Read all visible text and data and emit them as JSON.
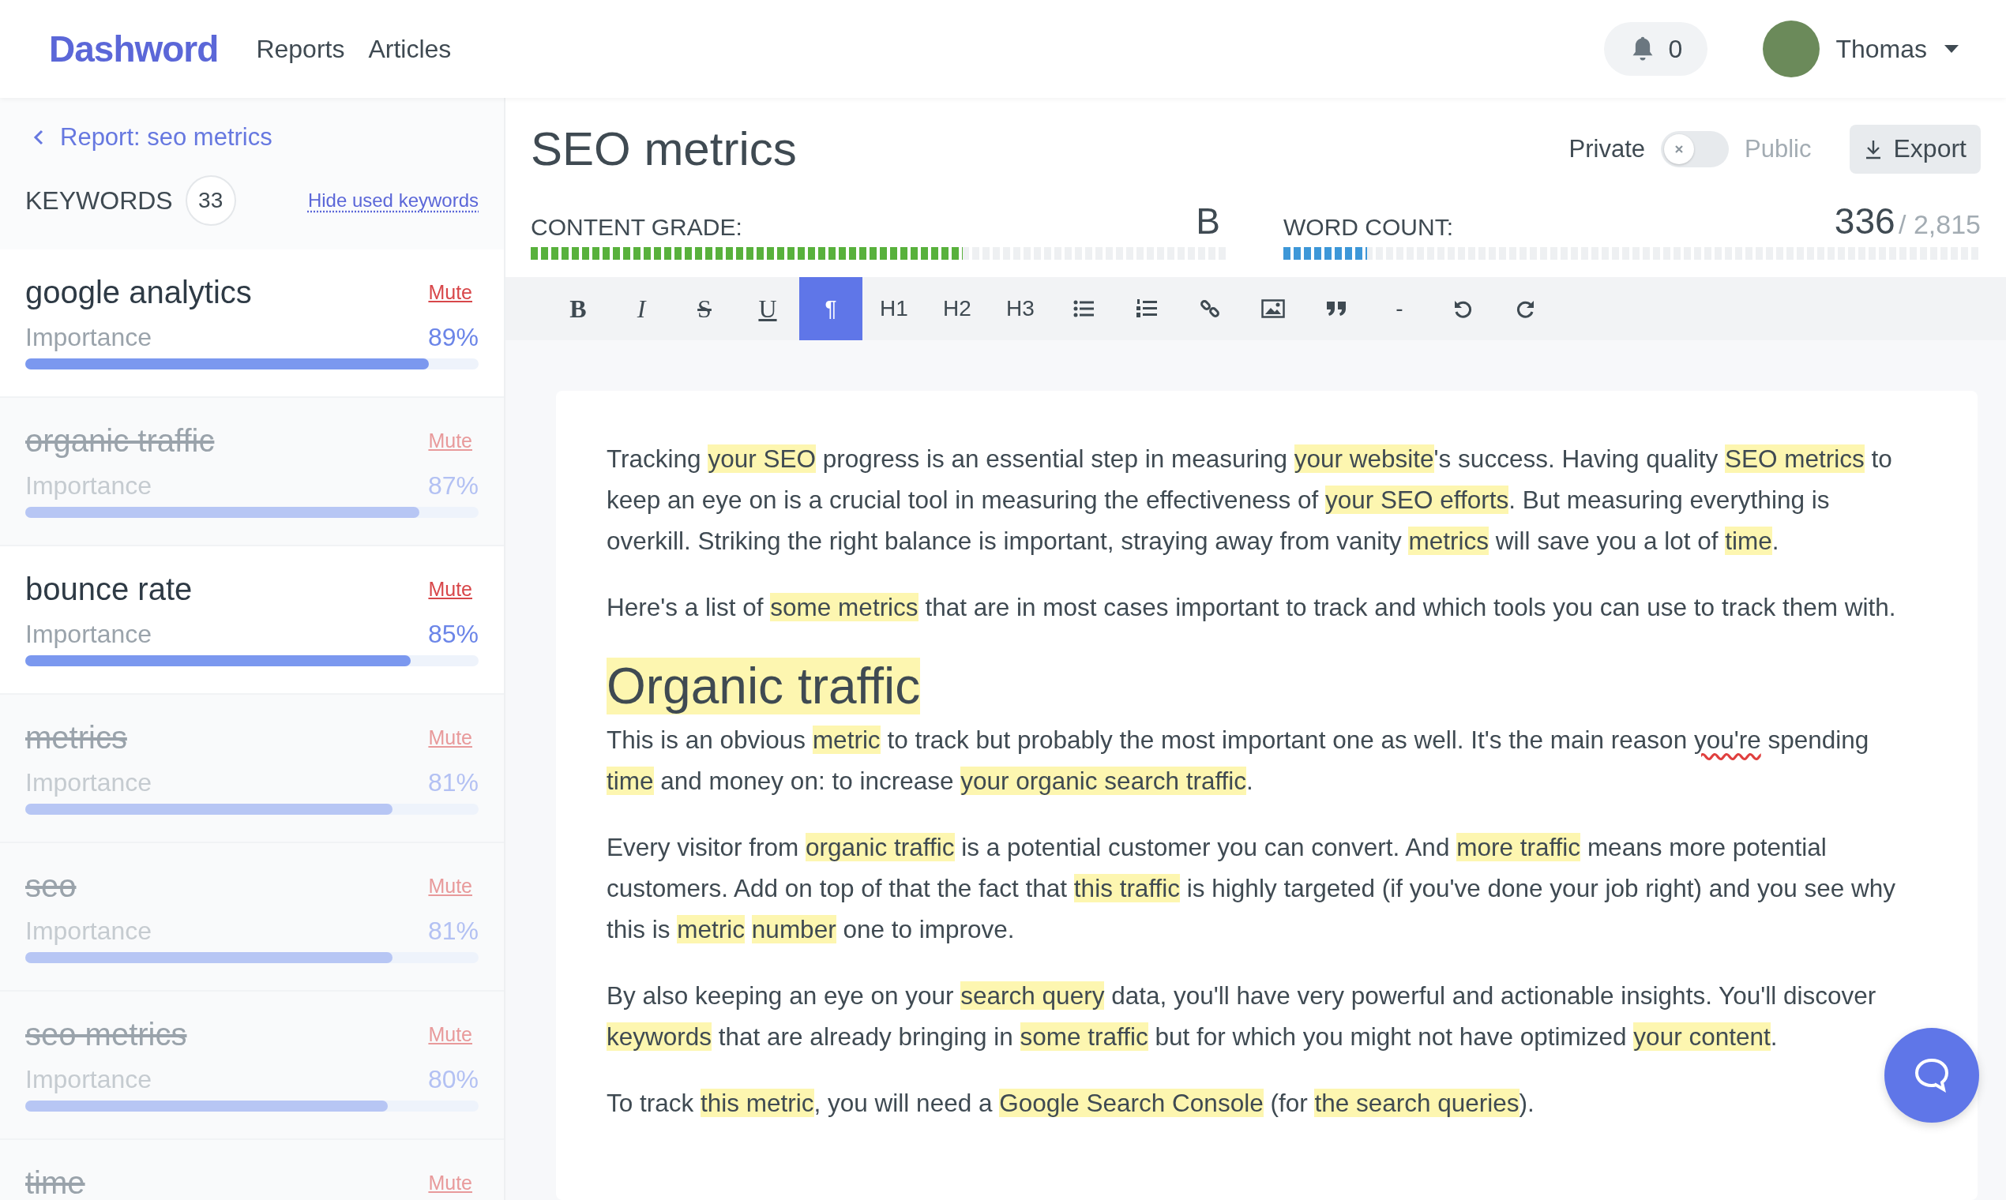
{
  "header": {
    "logo": "Dashword",
    "nav": [
      {
        "label": "Reports",
        "selected": false
      },
      {
        "label": "Articles",
        "selected": false
      }
    ],
    "notifications": "0",
    "user": "Thomas"
  },
  "sidebar": {
    "back_link": "Report: seo metrics",
    "keywords_label": "KEYWORDS",
    "keywords_count": "33",
    "hide_link": "Hide used keywords",
    "keywords": [
      {
        "name": "google analytics",
        "used": false,
        "mute": "Mute",
        "importance_label": "Importance",
        "importance": "89%",
        "level": 0.89
      },
      {
        "name": "organic traffic",
        "used": true,
        "mute": "Mute",
        "importance_label": "Importance",
        "importance": "87%",
        "level": 0.87
      },
      {
        "name": "bounce rate",
        "used": false,
        "mute": "Mute",
        "importance_label": "Importance",
        "importance": "85%",
        "level": 0.85
      },
      {
        "name": "metrics",
        "used": true,
        "mute": "Mute",
        "importance_label": "Importance",
        "importance": "81%",
        "level": 0.81
      },
      {
        "name": "seo",
        "used": true,
        "mute": "Mute",
        "importance_label": "Importance",
        "importance": "81%",
        "level": 0.81
      },
      {
        "name": "seo metrics",
        "used": true,
        "mute": "Mute",
        "importance_label": "Importance",
        "importance": "80%",
        "level": 0.8
      },
      {
        "name": "time",
        "used": true,
        "mute": "Mute"
      }
    ]
  },
  "document": {
    "title": "SEO metrics",
    "visibility": {
      "private_label": "Private",
      "public_label": "Public",
      "on": false
    },
    "export": "Export",
    "content_grade": {
      "label": "CONTENT GRADE:",
      "grade": "B",
      "level": 0.62
    },
    "word_count": {
      "label": "WORD COUNT:",
      "count": "336",
      "target": "/ 2,815",
      "level": 0.12
    },
    "toolbar": [
      {
        "kind": "bold",
        "label": "B",
        "selected": false
      },
      {
        "kind": "italic",
        "label": "I",
        "selected": false
      },
      {
        "kind": "strike",
        "label": "S",
        "selected": false
      },
      {
        "kind": "underline",
        "label": "U",
        "selected": false
      },
      {
        "kind": "text",
        "label": "¶",
        "selected": true
      },
      {
        "kind": "text",
        "label": "H1",
        "selected": false
      },
      {
        "kind": "text",
        "label": "H2",
        "selected": false
      },
      {
        "kind": "text",
        "label": "H3",
        "selected": false
      },
      {
        "kind": "bullets",
        "selected": false
      },
      {
        "kind": "numbers",
        "selected": false
      },
      {
        "kind": "link",
        "selected": false
      },
      {
        "kind": "image",
        "selected": false
      },
      {
        "kind": "quote",
        "selected": false
      },
      {
        "kind": "text",
        "label": "-",
        "selected": false
      },
      {
        "kind": "undo",
        "selected": false
      },
      {
        "kind": "redo",
        "selected": false
      }
    ],
    "blocks": [
      {
        "kind": "paragraph",
        "segments": [
          {
            "text": "Tracking "
          },
          {
            "text": "your SEO",
            "highlight": true
          },
          {
            "text": " progress is an essential step in measuring "
          },
          {
            "text": "your website",
            "highlight": true
          },
          {
            "text": "'s success. Having quality "
          },
          {
            "text": "SEO metrics",
            "highlight": true
          },
          {
            "text": " to keep an eye on is a crucial tool in measuring the effectiveness of "
          },
          {
            "text": "your SEO efforts",
            "highlight": true
          },
          {
            "text": ". But measuring everything is overkill. Striking the right balance is important, straying away from vanity "
          },
          {
            "text": "metrics",
            "highlight": true
          },
          {
            "text": " will save you a lot of "
          },
          {
            "text": "time",
            "highlight": true
          },
          {
            "text": "."
          }
        ]
      },
      {
        "kind": "paragraph",
        "segments": [
          {
            "text": "Here's a list of "
          },
          {
            "text": "some metrics",
            "highlight": true
          },
          {
            "text": " that are in most cases important to track and which tools you can use to track them with."
          }
        ]
      },
      {
        "kind": "heading",
        "segments": [
          {
            "text": "Organic traffic",
            "highlight": true
          }
        ]
      },
      {
        "kind": "paragraph",
        "segments": [
          {
            "text": "This is an obvious "
          },
          {
            "text": "metric",
            "highlight": true
          },
          {
            "text": " to track but probably the most important one as well. It's the main reason "
          },
          {
            "text": "you're",
            "misspelled": true
          },
          {
            "text": " spending "
          },
          {
            "text": "time",
            "highlight": true
          },
          {
            "text": " and money on: to increase "
          },
          {
            "text": "your organic search traffic",
            "highlight": true
          },
          {
            "text": "."
          }
        ]
      },
      {
        "kind": "paragraph",
        "segments": [
          {
            "text": "Every visitor from "
          },
          {
            "text": "organic traffic",
            "highlight": true
          },
          {
            "text": " is a potential customer you can convert. And "
          },
          {
            "text": "more traffic",
            "highlight": true
          },
          {
            "text": " means more potential customers. Add on top of that the fact that "
          },
          {
            "text": "this traffic",
            "highlight": true
          },
          {
            "text": " is highly targeted (if you've done your job right) and you see why this is "
          },
          {
            "text": "metric",
            "highlight": true
          },
          {
            "text": "number",
            "highlight": true,
            "space_before": true
          },
          {
            "text": " one to improve."
          }
        ]
      },
      {
        "kind": "paragraph",
        "segments": [
          {
            "text": "By also keeping an eye on your "
          },
          {
            "text": "search query",
            "highlight": true
          },
          {
            "text": " data, you'll have very powerful and actionable insights. You'll discover "
          },
          {
            "text": "keywords",
            "highlight": true
          },
          {
            "text": " that are already bringing in "
          },
          {
            "text": "some traffic",
            "highlight": true
          },
          {
            "text": " but for which you might not have optimized "
          },
          {
            "text": "your content",
            "highlight": true
          },
          {
            "text": "."
          }
        ]
      },
      {
        "kind": "paragraph",
        "segments": [
          {
            "text": "To track "
          },
          {
            "text": "this metric",
            "highlight": true
          },
          {
            "text": ", you will need a "
          },
          {
            "text": "Google Search Console",
            "highlight": true
          },
          {
            "text": " (for "
          },
          {
            "text": "the search queries",
            "highlight": true
          },
          {
            "text": ")."
          }
        ]
      }
    ]
  }
}
